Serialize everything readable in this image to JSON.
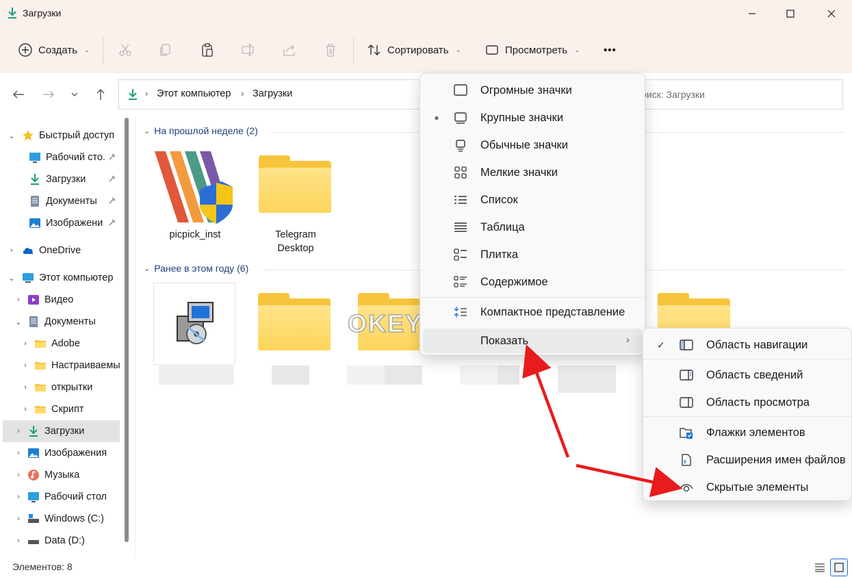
{
  "window": {
    "title": "Загрузки",
    "controls": [
      "minimize",
      "maximize",
      "close"
    ]
  },
  "toolbar": {
    "create_label": "Создать",
    "sort_label": "Сортировать",
    "view_label": "Просмотреть",
    "more_label": "•••"
  },
  "address": {
    "path": [
      "Этот компьютер",
      "Загрузки"
    ],
    "search_placeholder": "оиск: Загрузки"
  },
  "sidebar": {
    "items": [
      {
        "label": "Быстрый доступ",
        "icon": "star-icon"
      },
      {
        "label": "Рабочий сто.",
        "icon": "desktop-icon",
        "pinned": true
      },
      {
        "label": "Загрузки",
        "icon": "download-icon",
        "pinned": true
      },
      {
        "label": "Документы",
        "icon": "document-icon",
        "pinned": true
      },
      {
        "label": "Изображени",
        "icon": "picture-icon",
        "pinned": true
      },
      {
        "label": "OneDrive",
        "icon": "cloud-icon"
      },
      {
        "label": "Этот компьютер",
        "icon": "computer-icon"
      },
      {
        "label": "Видео",
        "icon": "video-icon"
      },
      {
        "label": "Документы",
        "icon": "document-icon"
      },
      {
        "label": "Adobe",
        "icon": "folder-icon"
      },
      {
        "label": "Настраиваемы",
        "icon": "folder-icon"
      },
      {
        "label": "открытки",
        "icon": "folder-icon"
      },
      {
        "label": "Скрипт",
        "icon": "folder-icon"
      },
      {
        "label": "Загрузки",
        "icon": "download-icon",
        "selected": true
      },
      {
        "label": "Изображения",
        "icon": "picture-icon"
      },
      {
        "label": "Музыка",
        "icon": "music-icon"
      },
      {
        "label": "Рабочий стол",
        "icon": "desktop-icon"
      },
      {
        "label": "Windows (C:)",
        "icon": "drive-icon"
      },
      {
        "label": "Data (D:)",
        "icon": "drive-icon"
      }
    ]
  },
  "content": {
    "groups": [
      {
        "header": "На прошлой неделе (2)",
        "files": [
          {
            "name": "picpick_inst",
            "icon": "picpick-installer-icon"
          },
          {
            "name": "Telegram Desktop",
            "name_line1": "Telegram",
            "name_line2": "Desktop",
            "icon": "folder-icon"
          }
        ]
      },
      {
        "header": "Ранее в этом году (6)",
        "files": [
          {
            "name": "",
            "icon": "setup-installer-icon"
          },
          {
            "name": "",
            "icon": "folder-icon"
          },
          {
            "name": "",
            "icon": "folder-icon"
          },
          {
            "name": "",
            "icon": "folder-icon"
          }
        ]
      }
    ]
  },
  "status": {
    "count_label": "Элементов: 8"
  },
  "view_menu": {
    "items": [
      {
        "label": "Огромные значки",
        "icon": "extra-large-icons-icon"
      },
      {
        "label": "Крупные значки",
        "icon": "large-icons-icon",
        "selected": true
      },
      {
        "label": "Обычные значки",
        "icon": "medium-icons-icon"
      },
      {
        "label": "Мелкие значки",
        "icon": "small-icons-icon"
      },
      {
        "label": "Список",
        "icon": "list-icon"
      },
      {
        "label": "Таблица",
        "icon": "details-icon"
      },
      {
        "label": "Плитка",
        "icon": "tiles-icon"
      },
      {
        "label": "Содержимое",
        "icon": "content-icon"
      },
      {
        "label": "Компактное представление",
        "icon": "compact-view-icon"
      },
      {
        "label": "Показать",
        "icon": "",
        "has_submenu": true
      }
    ]
  },
  "show_submenu": {
    "items": [
      {
        "label": "Область навигации",
        "icon": "navigation-pane-icon",
        "checked": true
      },
      {
        "label": "Область сведений",
        "icon": "details-pane-icon"
      },
      {
        "label": "Область просмотра",
        "icon": "preview-pane-icon"
      },
      {
        "label": "Флажки элементов",
        "icon": "item-checkboxes-icon"
      },
      {
        "label": "Расширения имен файлов",
        "icon": "file-extensions-icon"
      },
      {
        "label": "Скрытые элементы",
        "icon": "hidden-items-icon"
      }
    ]
  },
  "watermark": "OKEYGEEK",
  "colors": {
    "chrome": "#fbf1ec",
    "accent_arrow": "#e81c1c",
    "folder": "#f7c43d",
    "group_header": "#1f3f7a"
  }
}
